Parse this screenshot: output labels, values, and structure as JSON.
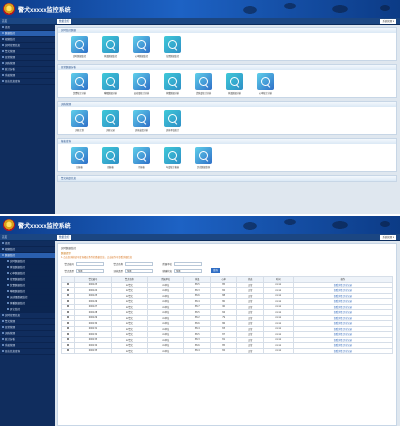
{
  "app": {
    "title": "警犬xxxxx监控系统"
  },
  "shot1": {
    "home_label": "首页",
    "tab_label": "数据监控",
    "right_label": "系统管理 ▾",
    "sidebar": [
      {
        "label": "首页",
        "type": "top"
      },
      {
        "label": "数据监控",
        "type": "active"
      },
      {
        "label": "视频监控",
        "type": "top"
      },
      {
        "label": "实时位置信息",
        "type": "top"
      },
      {
        "label": "警犬管理",
        "type": "top"
      },
      {
        "label": "日常管理",
        "type": "top"
      },
      {
        "label": "训练管理",
        "type": "top"
      },
      {
        "label": "统计分析",
        "type": "top"
      },
      {
        "label": "系统管理",
        "type": "top"
      },
      {
        "label": "日志信息查询",
        "type": "top"
      }
    ],
    "sections": [
      {
        "title": "实时监控数据",
        "items": [
          "实时数据监控",
          "体温数据监控",
          "心率数据监控",
          "位置数据监控"
        ]
      },
      {
        "title": "日常数据分析",
        "items": [
          "饮食统计分析",
          "睡眠数据分析",
          "运动量统计分析",
          "体重数据分析",
          "活跃度统计分析",
          "体温数据分析",
          "心率统计分析"
        ]
      },
      {
        "title": "训练管理",
        "items": [
          "训练计划",
          "训练记录",
          "训练成绩分析",
          "训练考核统计"
        ]
      },
      {
        "title": "报表查询",
        "items": [
          "日报表",
          "周报表",
          "月报表",
          "年度统计报表",
          "历史数据查询"
        ]
      },
      {
        "title": "警犬档案信息",
        "items": []
      }
    ]
  },
  "shot2": {
    "home_label": "首页",
    "tab_label": "数据监控",
    "right_label": "系统管理 ▾",
    "sidebar": [
      {
        "label": "首页",
        "type": "top"
      },
      {
        "label": "视频监控",
        "type": "top"
      },
      {
        "label": "数据监控",
        "type": "active"
      },
      {
        "label": "实时数据监控",
        "type": "sub"
      },
      {
        "label": "体温数据监控",
        "type": "sub"
      },
      {
        "label": "心率数据监控",
        "type": "sub"
      },
      {
        "label": "位置数据监控",
        "type": "sub"
      },
      {
        "label": "饮食数据监控",
        "type": "sub"
      },
      {
        "label": "睡眠数据监控",
        "type": "sub"
      },
      {
        "label": "运动量数据监控",
        "type": "sub"
      },
      {
        "label": "体重数据监控",
        "type": "sub"
      },
      {
        "label": "其它监控",
        "type": "sub"
      },
      {
        "label": "实时位置信息",
        "type": "top"
      },
      {
        "label": "警犬管理",
        "type": "top"
      },
      {
        "label": "日常管理",
        "type": "top"
      },
      {
        "label": "训练管理",
        "type": "top"
      },
      {
        "label": "统计分析",
        "type": "top"
      },
      {
        "label": "系统管理",
        "type": "top"
      },
      {
        "label": "日志信息查询",
        "type": "top"
      }
    ],
    "breadcrumb": "实时数据监控",
    "note_title": "数据提示",
    "note": "1.点击查询按钮可查询相应条件的数据信息，点击操作可查看详细信息",
    "form": {
      "row1": [
        {
          "label": "警犬编号",
          "value": ""
        },
        {
          "label": "警犬名称",
          "value": ""
        },
        {
          "label": "所属单位",
          "value": ""
        }
      ],
      "row2": [
        {
          "label": "警犬类型",
          "value": "全部"
        },
        {
          "label": "训练类型",
          "value": "全部"
        },
        {
          "label": "健康状态",
          "value": "全部"
        }
      ],
      "query_label": "查询"
    },
    "table": {
      "headers": [
        "",
        "警犬编号",
        "警犬名称",
        "所属单位",
        "体温",
        "心率",
        "状态",
        "时间",
        "操作"
      ],
      "rows": [
        [
          "",
          "000123",
          "xx警犬",
          "xx单位",
          "38.5",
          "85",
          "正常",
          "xx:xx",
          "查看详情  历史记录"
        ],
        [
          "",
          "000124",
          "xx警犬",
          "xx单位",
          "38.3",
          "82",
          "正常",
          "xx:xx",
          "查看详情  历史记录"
        ],
        [
          "",
          "000125",
          "xx警犬",
          "xx单位",
          "38.6",
          "88",
          "正常",
          "xx:xx",
          "查看详情  历史记录"
        ],
        [
          "",
          "000126",
          "xx警犬",
          "xx单位",
          "38.4",
          "80",
          "正常",
          "xx:xx",
          "查看详情  历史记录"
        ],
        [
          "",
          "000127",
          "xx警犬",
          "xx单位",
          "38.7",
          "90",
          "正常",
          "xx:xx",
          "查看详情  历史记录"
        ],
        [
          "",
          "000128",
          "xx警犬",
          "xx单位",
          "38.5",
          "84",
          "正常",
          "xx:xx",
          "查看详情  历史记录"
        ],
        [
          "",
          "000129",
          "xx警犬",
          "xx单位",
          "38.2",
          "79",
          "正常",
          "xx:xx",
          "查看详情  历史记录"
        ],
        [
          "",
          "000130",
          "xx警犬",
          "xx单位",
          "38.6",
          "86",
          "正常",
          "xx:xx",
          "查看详情  历史记录"
        ],
        [
          "",
          "000131",
          "xx警犬",
          "xx单位",
          "38.4",
          "83",
          "正常",
          "xx:xx",
          "查看详情  历史记录"
        ],
        [
          "",
          "000132",
          "xx警犬",
          "xx单位",
          "38.5",
          "87",
          "正常",
          "xx:xx",
          "查看详情  历史记录"
        ],
        [
          "",
          "000133",
          "xx警犬",
          "xx单位",
          "38.3",
          "81",
          "正常",
          "xx:xx",
          "查看详情  历史记录"
        ],
        [
          "",
          "000134",
          "xx警犬",
          "xx单位",
          "38.6",
          "85",
          "正常",
          "xx:xx",
          "查看详情  历史记录"
        ],
        [
          "",
          "000135",
          "xx警犬",
          "xx单位",
          "38.4",
          "82",
          "正常",
          "xx:xx",
          "查看详情  历史记录"
        ]
      ]
    }
  }
}
